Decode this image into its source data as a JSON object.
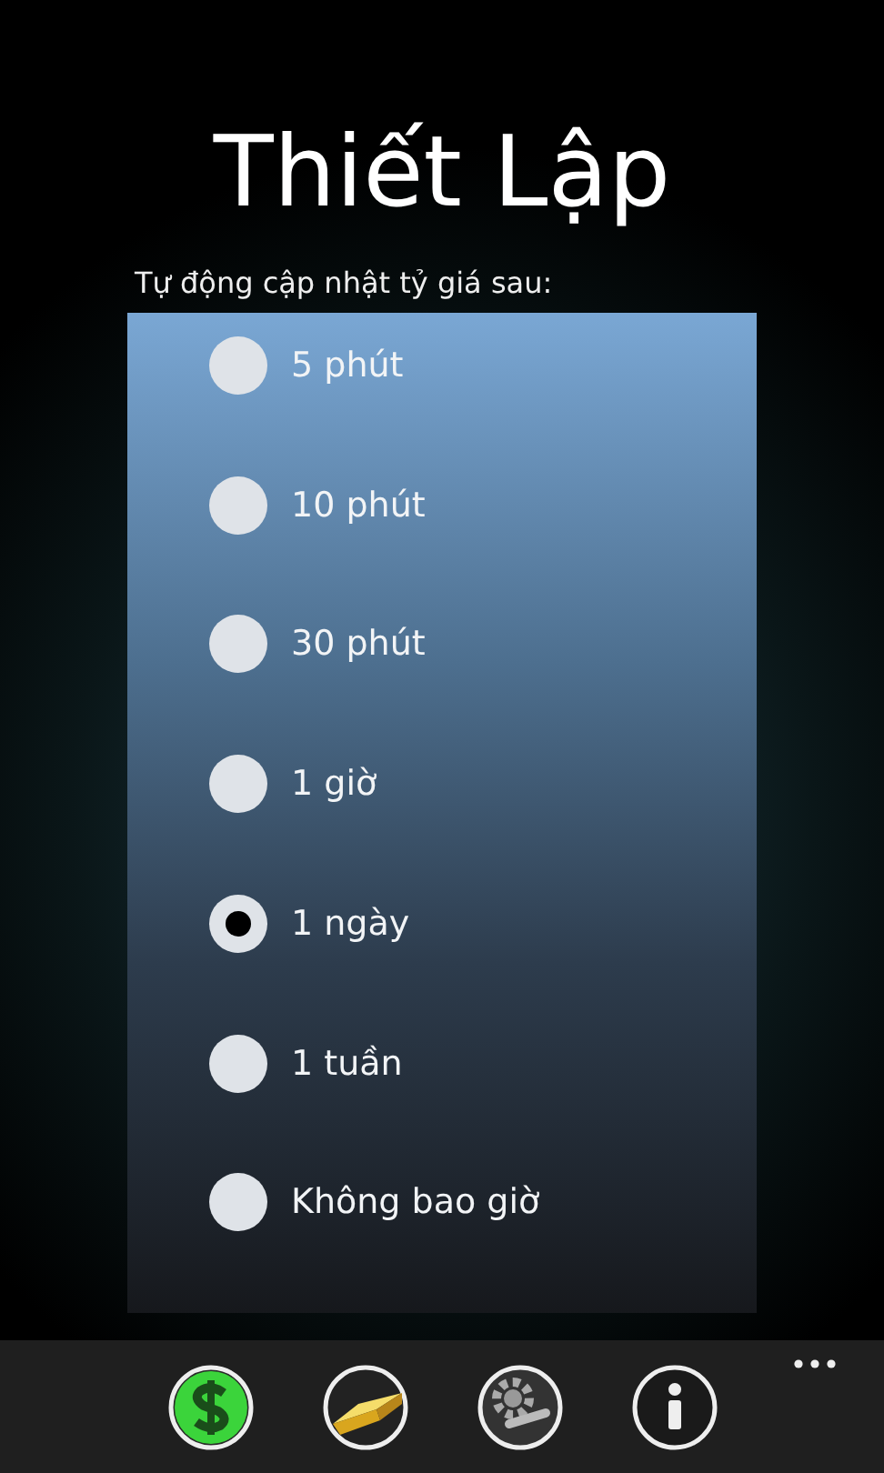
{
  "title": "Thiết Lập",
  "prompt": "Tự động cập nhật tỷ giá sau:",
  "options": [
    {
      "label": "5 phút",
      "selected": false
    },
    {
      "label": "10 phút",
      "selected": false
    },
    {
      "label": "30 phút",
      "selected": false
    },
    {
      "label": "1 giờ",
      "selected": false
    },
    {
      "label": "1 ngày",
      "selected": true
    },
    {
      "label": "1 tuần",
      "selected": false
    },
    {
      "label": "Không bao giờ",
      "selected": false
    }
  ],
  "app_bar": {
    "buttons": [
      {
        "kind": "dollar"
      },
      {
        "kind": "gold"
      },
      {
        "kind": "settings"
      },
      {
        "kind": "info"
      }
    ]
  }
}
